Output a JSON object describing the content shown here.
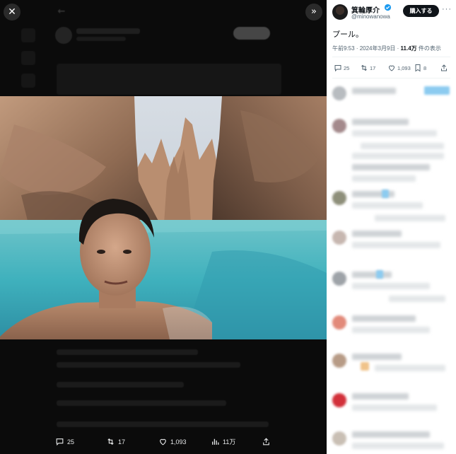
{
  "viewer": {
    "close_icon": "close-icon",
    "expand_icon": "chevron-double-right-icon",
    "actions": [
      {
        "name": "reply",
        "icon": "comment-icon",
        "count": "25"
      },
      {
        "name": "repost",
        "icon": "repost-icon",
        "count": "17"
      },
      {
        "name": "like",
        "icon": "heart-icon",
        "count": "1,093"
      },
      {
        "name": "views",
        "icon": "bar-chart-icon",
        "count": "11万"
      },
      {
        "name": "share",
        "icon": "share-icon",
        "count": ""
      }
    ]
  },
  "tweet": {
    "author_name": "箕輪厚介",
    "author_handle": "@minowanowa",
    "buy_button_label": "購入する",
    "more_label": "···",
    "text": "プール。",
    "time": "午前9:53",
    "date": "2024年3月9日",
    "views_count": "11.4万",
    "views_suffix": "件の表示",
    "stats": {
      "replies": "25",
      "reposts": "17",
      "likes": "1,093",
      "bookmarks": "8"
    }
  },
  "colors": {
    "accent": "#1d9bf0",
    "panel_bg": "#ffffff",
    "viewer_bg": "#0b0b0b",
    "text_primary": "#0f1419",
    "text_secondary": "#536471"
  }
}
